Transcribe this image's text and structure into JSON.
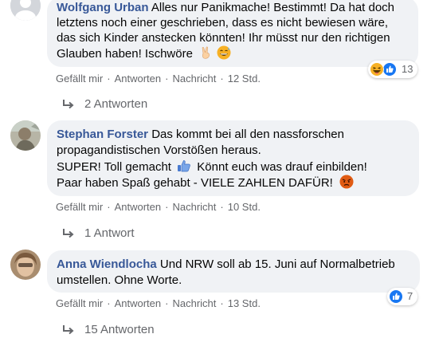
{
  "comments": [
    {
      "author": "Wolfgang Urban",
      "lines": [
        "Alles nur Panikmache! Bestimmt! Da hat doch",
        "letztens noch einer geschrieben, dass es nicht bewiesen wäre,",
        "das sich Kinder anstecken könnten! Ihr müsst nur den richtigen",
        "Glauben haben! Ischwöre"
      ],
      "inline_emojis": [
        "victory-hand-emoji",
        "grinning-sweat-emoji"
      ],
      "actions": {
        "like": "Gefällt mir",
        "reply": "Antworten",
        "message": "Nachricht",
        "time": "12 Std."
      },
      "reactions": {
        "icons": [
          "haha",
          "like"
        ],
        "count": "13"
      },
      "replies": "2 Antworten"
    },
    {
      "author": "Stephan Forster",
      "lines": [
        "Das kommt bei all den nassforschen",
        "propagandistischen Vorstößen heraus.",
        "SUPER! Toll gemacht",
        "Könnt euch was drauf einbilden!",
        "Paar haben Spaß gehabt - VIELE ZAHLEN DAFÜR!"
      ],
      "inline_emojis": [
        "thumbs-up-emoji",
        "angry-face-emoji"
      ],
      "actions": {
        "like": "Gefällt mir",
        "reply": "Antworten",
        "message": "Nachricht",
        "time": "10 Std."
      },
      "replies": "1 Antwort"
    },
    {
      "author": "Anna Wiendlocha",
      "lines": [
        "Und NRW soll ab 15. Juni auf Normalbetrieb",
        "umstellen. Ohne Worte."
      ],
      "actions": {
        "like": "Gefällt mir",
        "reply": "Antworten",
        "message": "Nachricht",
        "time": "13 Std."
      },
      "reactions": {
        "icons": [
          "like"
        ],
        "count": "7"
      },
      "replies": "15 Antworten"
    }
  ],
  "colors": {
    "bubble": "#f0f2f5",
    "author": "#385898",
    "meta": "#65676b",
    "like": "#1877f2",
    "haha": "#f7b125",
    "angry": "#e9710f"
  }
}
